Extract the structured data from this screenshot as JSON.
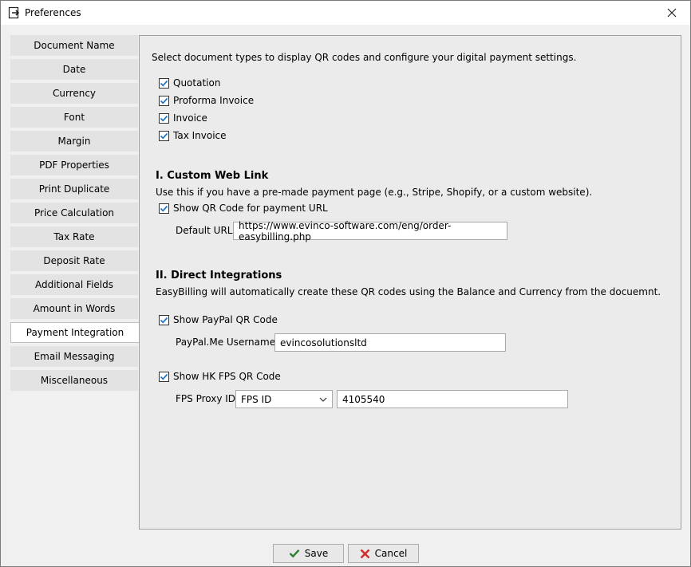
{
  "window": {
    "title": "Preferences"
  },
  "sidebar": {
    "items": [
      {
        "label": "Document Name"
      },
      {
        "label": "Date"
      },
      {
        "label": "Currency"
      },
      {
        "label": "Font"
      },
      {
        "label": "Margin"
      },
      {
        "label": "PDF Properties"
      },
      {
        "label": "Print Duplicate"
      },
      {
        "label": "Price Calculation"
      },
      {
        "label": "Tax Rate"
      },
      {
        "label": "Deposit Rate"
      },
      {
        "label": "Additional Fields"
      },
      {
        "label": "Amount in Words"
      },
      {
        "label": "Payment Integration",
        "active": true
      },
      {
        "label": "Email Messaging"
      },
      {
        "label": "Miscellaneous"
      }
    ]
  },
  "main": {
    "intro": "Select document types to display QR codes and configure your digital payment settings.",
    "doc_types": [
      {
        "label": "Quotation",
        "checked": true
      },
      {
        "label": "Proforma Invoice",
        "checked": true
      },
      {
        "label": "Invoice",
        "checked": true
      },
      {
        "label": "Tax Invoice",
        "checked": true
      }
    ],
    "custom_link": {
      "title": "I. Custom Web Link",
      "description": "Use this if you have a pre-made payment page (e.g., Stripe, Shopify, or a custom website).",
      "show_label": "Show QR Code for payment URL",
      "show_checked": true,
      "url_label": "Default URL",
      "url_value": "https://www.evinco-software.com/eng/order-easybilling.php"
    },
    "direct": {
      "title": "II. Direct Integrations",
      "description": "EasyBilling will automatically create these QR codes using the Balance and Currency from the docuemnt.",
      "paypal_show_label": "Show PayPal QR Code",
      "paypal_checked": true,
      "paypal_user_label": "PayPal.Me Username",
      "paypal_user_value": "evincosolutionsltd",
      "fps_show_label": "Show HK FPS QR Code",
      "fps_checked": true,
      "fps_proxy_label": "FPS Proxy ID",
      "fps_proxy_type": "FPS ID",
      "fps_proxy_value": "4105540"
    }
  },
  "footer": {
    "save_label": "Save",
    "cancel_label": "Cancel"
  },
  "colors": {
    "accent_check": "#1a73c8",
    "cancel_red": "#d32f2f",
    "save_green": "#2e7d32"
  }
}
